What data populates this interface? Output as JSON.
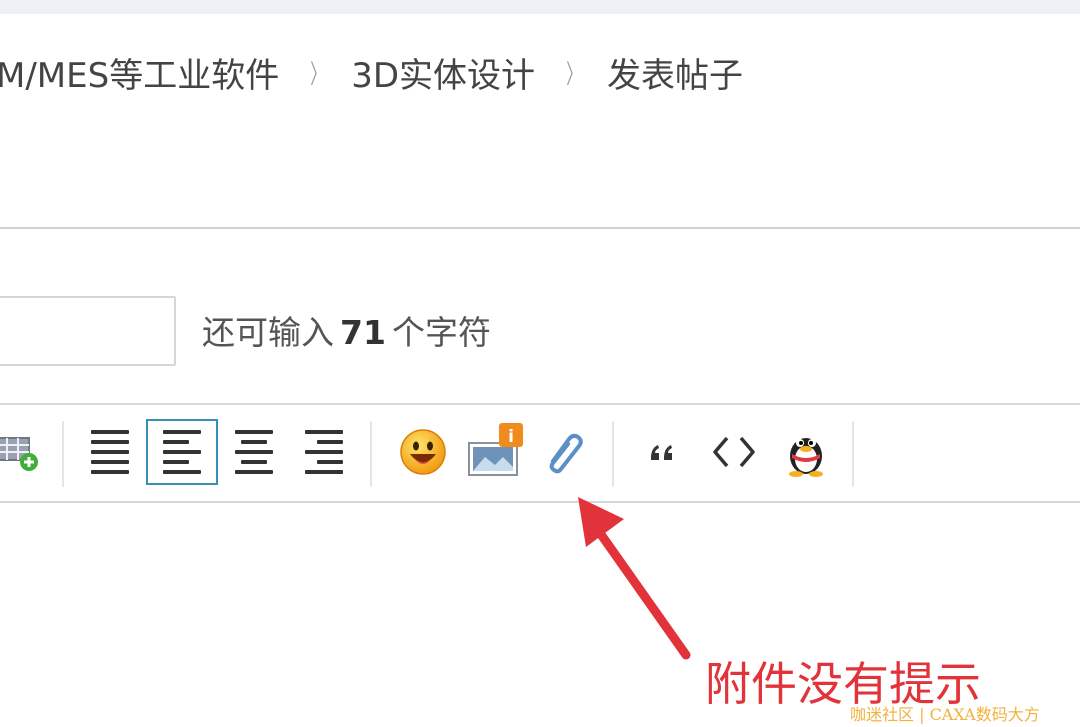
{
  "breadcrumb": {
    "items": [
      "M/MES等工业软件",
      "3D实体设计",
      "发表帖子"
    ],
    "separator": "〉"
  },
  "subject": {
    "value": "",
    "remaining_prefix": "还可输入",
    "remaining_count": "71",
    "remaining_suffix": "个字符"
  },
  "toolbar": {
    "groups": [
      {
        "items": [
          "insert-table-icon"
        ]
      },
      {
        "items": [
          "align-justify-icon",
          "align-left-icon",
          "align-center-icon",
          "align-right-icon"
        ],
        "active": "align-left-icon"
      },
      {
        "items": [
          "smiley-icon",
          "image-icon",
          "attachment-paperclip-icon"
        ]
      },
      {
        "items": [
          "quote-icon",
          "code-icon",
          "qq-penguin-icon"
        ]
      }
    ],
    "image_badge": "i"
  },
  "annotation": {
    "text": "附件没有提示",
    "color": "#e2333b"
  },
  "watermark": {
    "text": "咖迷社区 | CAXA数码大方"
  }
}
